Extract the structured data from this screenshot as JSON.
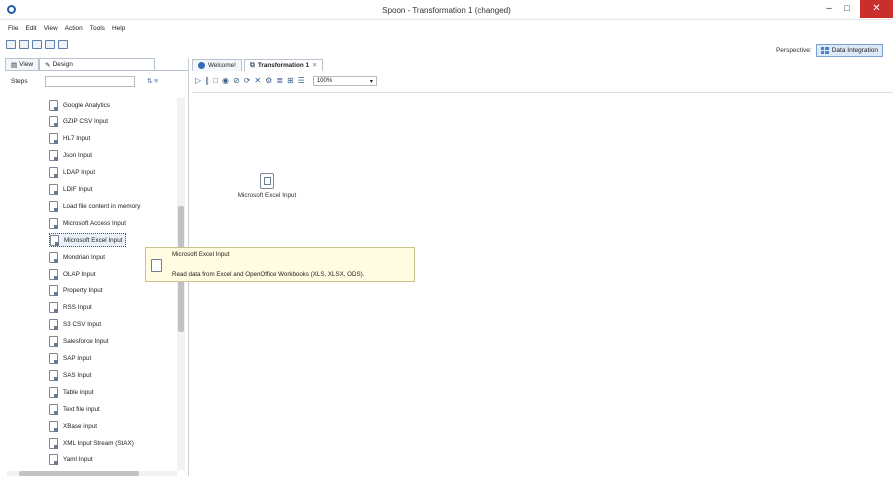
{
  "window": {
    "title": "Spoon - Transformation 1 (changed)",
    "min_glyph": "–",
    "max_glyph": "□",
    "close_glyph": "✕"
  },
  "menu": [
    "File",
    "Edit",
    "View",
    "Action",
    "Tools",
    "Help"
  ],
  "toolbar": {
    "icons": [
      "new-file-icon",
      "open-icon",
      "explore-repository-icon",
      "save-icon",
      "save-as-icon"
    ]
  },
  "perspective": {
    "label": "Perspective:",
    "button": "Data Integration"
  },
  "left_panel": {
    "tabs": [
      "View",
      "Design"
    ],
    "steps_label": "Steps",
    "steps_tools": "⇅ ≡",
    "steps": [
      "Google Analytics",
      "GZIP CSV Input",
      "HL7 Input",
      "Json Input",
      "LDAP Input",
      "LDIF Input",
      "Load file content in memory",
      "Microsoft Access Input",
      "Microsoft Excel Input",
      "Mondrian Input",
      "OLAP Input",
      "Property Input",
      "RSS Input",
      "S3 CSV Input",
      "Salesforce Input",
      "SAP Input",
      "SAS Input",
      "Table input",
      "Text file input",
      "XBase input",
      "XML Input Stream (StAX)",
      "Yaml Input"
    ],
    "selected_step": "Microsoft Excel Input"
  },
  "tabs": {
    "welcome": "Welcome!",
    "transformation": "Transformation 1",
    "close_glyph": "✕"
  },
  "canvas_toolbar": {
    "icons": [
      "run-icon",
      "pause-icon",
      "stop-icon",
      "preview-icon",
      "debug-icon",
      "replay-icon",
      "verify-icon",
      "impact-icon",
      "sql-icon",
      "explore-db-icon",
      "show-results-icon"
    ],
    "glyphs": [
      "▷",
      "∥",
      "□",
      "◉",
      "⊘",
      "⟳",
      "✕",
      "⚙",
      "≣",
      "⊞",
      "☰"
    ],
    "zoom": "100%"
  },
  "canvas": {
    "step_label": "Microsoft Excel Input"
  },
  "tooltip": {
    "title": "Microsoft Excel Input",
    "description": "Read data from Excel and OpenOffice Workbooks (XLS, XLSX, ODS)."
  }
}
